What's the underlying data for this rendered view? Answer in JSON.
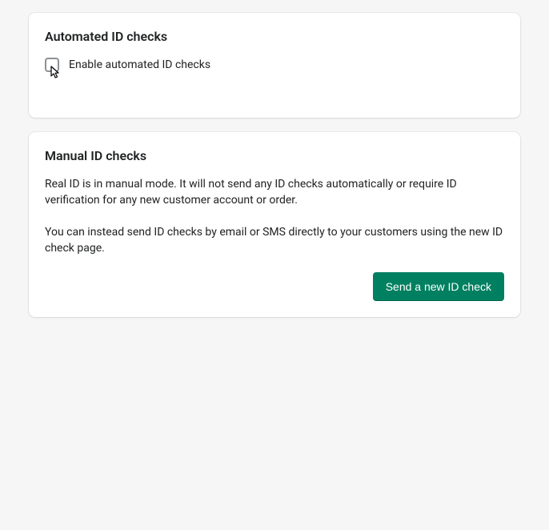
{
  "automated": {
    "title": "Automated ID checks",
    "checkbox_label": "Enable automated ID checks",
    "checked": false
  },
  "manual": {
    "title": "Manual ID checks",
    "description_1": "Real ID is in manual mode. It will not send any ID checks automatically or require ID verification for any new customer account or order.",
    "description_2": "You can instead send ID checks by email or SMS directly to your customers using the new ID check page.",
    "button_label": "Send a new ID check"
  }
}
